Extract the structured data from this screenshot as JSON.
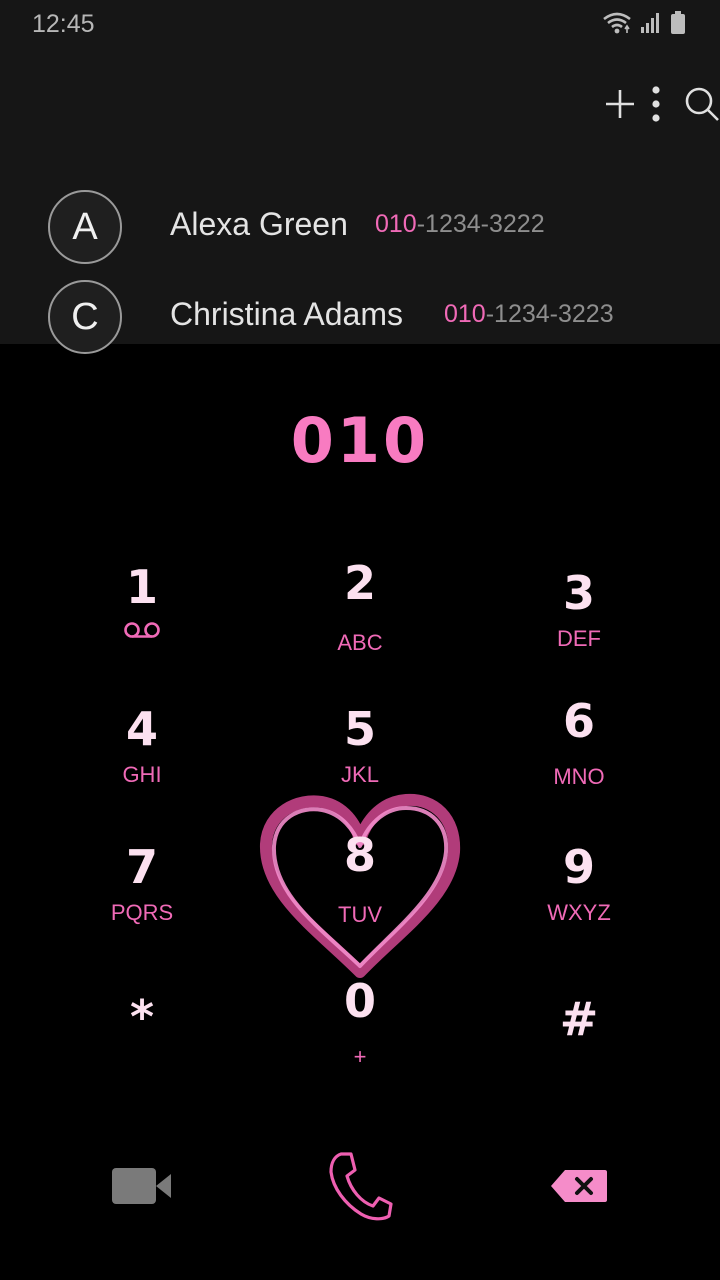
{
  "status_bar": {
    "time": "12:45",
    "icons": [
      "wifi-icon",
      "signal-icon",
      "battery-icon"
    ]
  },
  "toolbar": {
    "icons": [
      "plus-icon",
      "search-icon",
      "more-vert-icon"
    ]
  },
  "contacts": [
    {
      "initial": "A",
      "name": "Alexa Green",
      "number_match": "010",
      "number_rest": "-1234-3222"
    },
    {
      "initial": "C",
      "name": "Christina Adams",
      "number_match": "010",
      "number_rest": "-1234-3223"
    }
  ],
  "dialed": "010",
  "keys": [
    {
      "digit": "1",
      "letters": "",
      "icon": "voicemail-icon"
    },
    {
      "digit": "2",
      "letters": "ABC"
    },
    {
      "digit": "3",
      "letters": "DEF"
    },
    {
      "digit": "4",
      "letters": "GHI"
    },
    {
      "digit": "5",
      "letters": "JKL"
    },
    {
      "digit": "6",
      "letters": "MNO"
    },
    {
      "digit": "7",
      "letters": "PQRS"
    },
    {
      "digit": "8",
      "letters": "TUV"
    },
    {
      "digit": "9",
      "letters": "WXYZ"
    },
    {
      "digit": "*",
      "letters": ""
    },
    {
      "digit": "0",
      "letters": "+"
    },
    {
      "digit": "#",
      "letters": ""
    }
  ],
  "bottom_icons": [
    "video-call-icon",
    "call-icon",
    "backspace-icon"
  ],
  "colors": {
    "accent": "#f06ab7",
    "digit": "#fce1f0",
    "top_panel": "#161616",
    "background": "#000000"
  }
}
